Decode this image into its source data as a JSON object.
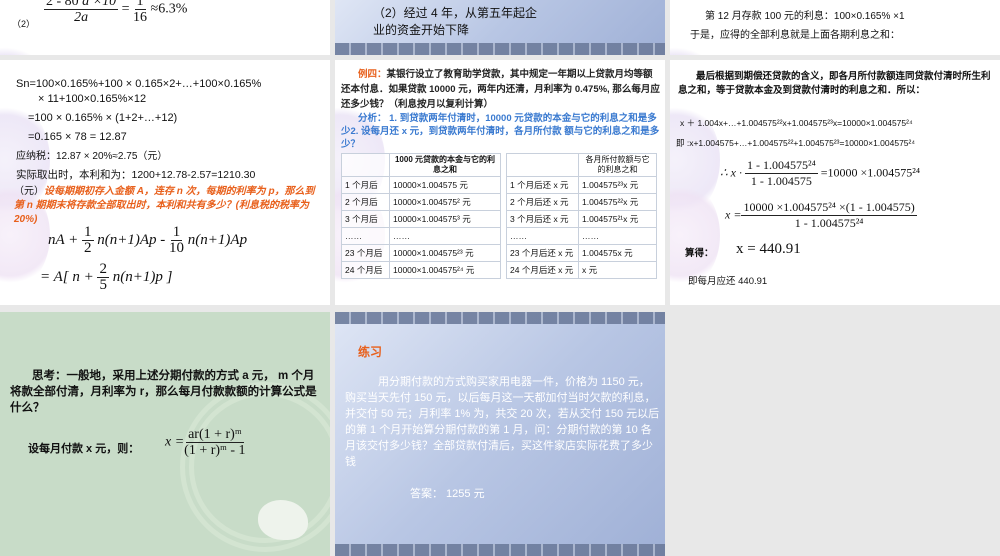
{
  "slide1": {
    "label": "（2）",
    "num1": "2",
    "num2": "80",
    "num3": "a ×10",
    "den": "2a",
    "eq": "=",
    "frac_n": "1",
    "frac_d": "16",
    "approx": "≈6.3%"
  },
  "slide2": {
    "line1": "（2）经过 4 年，从第五年起企",
    "line2": "业的资金开始下降"
  },
  "slide3": {
    "line1": "第 12 月存款 100 元的利息：100×0.165% ×1",
    "line2": "于是，应得的全部利息就是上面各期利息之和："
  },
  "slide4": {
    "l1": "Sn=100×0.165%+100 × 0.165×2+…+100×0.165%",
    "l2": "× 11+100×0.165%×12",
    "l3": "=100 × 0.165% × (1+2+…+12)",
    "l4": "=0.165 × 78 = 12.87",
    "l5": "应纳税：12.87 × 20%≈2.75（元）",
    "l6": "实际取出时，本利和为：1200+12.78-2.57=1210.30",
    "l7": "（元）",
    "hand": "设每期期初存入金额 A，连存 n 次，每期的利率为 p，那么到第 n 期期末将存款全部取出时，本利和共有多少？(利息税的税率为 20%)",
    "f1a": "nA +",
    "f1b": "1",
    "f1c": "2",
    "f1d": "n(n+1)Ap -",
    "f1e": "1",
    "f1f": "10",
    "f1g": "n(n+1)Ap",
    "f2a": "= A[ n +",
    "f2b": "2",
    "f2c": "5",
    "f2d": "n(n+1)p ]"
  },
  "slide5": {
    "title": "例四：",
    "text": "某银行设立了教育助学贷款，其中规定一年期以上贷款月均等额还本付息．如果贷款 10000 元，两年内还清，月利率为 0.475%, 那么每月应还多少钱？（利息按月以复利计算）",
    "analysis": "分析：  1. 到贷款两年付清时，10000 元贷款的本金与它的利息之和是多少2. 设每月还 x 元，到贷款两年付清时，各月所付款 额与它的利息之和是多少？",
    "table1": {
      "header": [
        "",
        "1000 元贷款的本金与它的利息之和"
      ],
      "rows": [
        [
          "1 个月后",
          "10000×1.004575 元"
        ],
        [
          "2 个月后",
          "10000×1.004575² 元"
        ],
        [
          "3 个月后",
          "10000×1.004575³ 元"
        ],
        [
          "……",
          "……"
        ],
        [
          "23 个月后",
          "10000×1.004575²³ 元"
        ],
        [
          "24 个月后",
          "10000×1.004575²⁴ 元"
        ]
      ]
    },
    "table2": {
      "header": [
        "",
        "各月所付款额与它的利息之和"
      ],
      "rows": [
        [
          "1 个月后还 x 元",
          "1.004575²³x 元"
        ],
        [
          "2 个月后还 x 元",
          "1.004575²²x 元"
        ],
        [
          "3 个月后还 x 元",
          "1.004575²¹x 元"
        ],
        [
          "……",
          "……"
        ],
        [
          "23 个月后还 x 元",
          "1.004575x  元"
        ],
        [
          "24 个月后还 x 元",
          "x      元"
        ]
      ]
    }
  },
  "slide6": {
    "intro": "最后根据到期偿还贷款的含义，即各月所付款额连同贷款付清时所生利息之和，等于贷款本金及到贷款付清时的利息之和．所以：",
    "eq1": "x ＋ 1.004x+…+1.004575²²x+1.004575²³x=10000×1.004575²⁴",
    "eq2": "即 :x+1.004575+…+1.004575²²+1.004575²³=10000×1.004575²⁴",
    "f1l": "∴ x ·",
    "f1n": "1 - 1.004575²⁴",
    "f1d": "1 - 1.004575",
    "f1r": "=10000 ×1.004575²⁴",
    "f2l": "x =",
    "f2n": "10000 ×1.004575²⁴ ×(1 - 1.004575)",
    "f2d": "1 - 1.004575²⁴",
    "calc_label": "算得：",
    "calc": "x = 440.91",
    "answer": "即每月应还  440.91"
  },
  "slide7": {
    "text": "思考：一般地，采用上述分期付款的方式 a 元， m 个月将款全部付清，月利率为 r，那么每月付款款额的计算公式是什么？",
    "let": "设每月付款 x 元，则：",
    "fl": "x =",
    "fn": "ar(1 + r)ᵐ",
    "fd": "(1 + r)ᵐ - 1"
  },
  "slide8": {
    "title": "练习",
    "text": "用分期付款的方式购买家用电器一件，价格为 1150 元，购买当天先付 150 元，以后每月这一天都加付当时欠款的利息，并交付 50 元；月利率 1% 为，共交 20 次，若从交付 150 元以后的第 1 个月开始算分期付款的第 1 月，问：分期付款的第 10 各月该交付多少钱？全部贷款付清后，买这件家店实际花费了多少钱",
    "answer": "答案：  1255 元"
  }
}
